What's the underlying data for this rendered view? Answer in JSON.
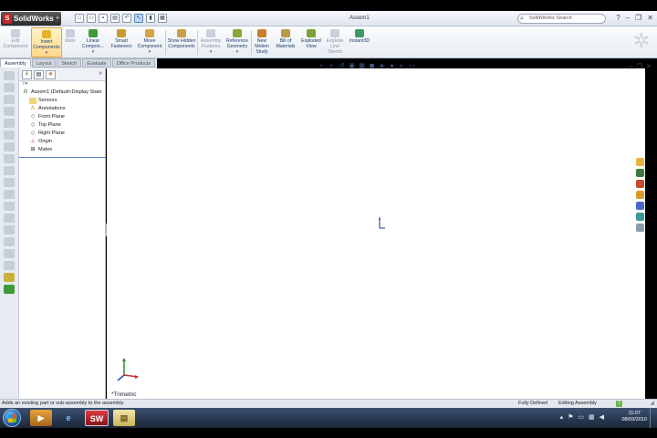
{
  "app": {
    "logo_text": "SolidWorks",
    "window_title": "Assem1",
    "search_placeholder": "SolidWorks Search"
  },
  "commands": [
    {
      "id": "edit-component",
      "label": "Edit Component",
      "enabled": false
    },
    {
      "id": "insert-components",
      "label": "Insert Components",
      "enabled": true,
      "active": true
    },
    {
      "id": "mate",
      "label": "Mate",
      "enabled": false
    },
    {
      "id": "linear-component-pattern",
      "label": "Linear Compon...",
      "enabled": true
    },
    {
      "id": "smart-fasteners",
      "label": "Smart Fasteners",
      "enabled": true
    },
    {
      "id": "move-component",
      "label": "Move Component",
      "enabled": true
    },
    {
      "id": "show-hidden-components",
      "label": "Show Hidden Components",
      "enabled": true
    },
    {
      "id": "assembly-features",
      "label": "Assembly Features",
      "enabled": false
    },
    {
      "id": "reference-geometry",
      "label": "Reference Geometry",
      "enabled": true
    },
    {
      "id": "new-motion-study",
      "label": "New Motion Study",
      "enabled": true
    },
    {
      "id": "bill-of-materials",
      "label": "Bill of Materials",
      "enabled": true
    },
    {
      "id": "exploded-view",
      "label": "Exploded View",
      "enabled": true
    },
    {
      "id": "explode-line-sketch",
      "label": "Explode Line Sketch",
      "enabled": false
    },
    {
      "id": "instant3d",
      "label": "Instant3D",
      "enabled": true
    }
  ],
  "tabs": [
    {
      "label": "Assembly",
      "active": true
    },
    {
      "label": "Layout",
      "active": false
    },
    {
      "label": "Sketch",
      "active": false
    },
    {
      "label": "Evaluate",
      "active": false
    },
    {
      "label": "Office Products",
      "active": false
    }
  ],
  "tree": {
    "root": "Assem1  (Default<Display State",
    "items": [
      "Sensors",
      "Annotations",
      "Front Plane",
      "Top Plane",
      "Right Plane",
      "Origin",
      "Mates"
    ]
  },
  "viewport": {
    "view_name": "*Trimetric"
  },
  "status": {
    "message": "Adds an existing part or sub-assembly to the assembly.",
    "state": "Fully Defined",
    "mode": "Editing Assembly"
  },
  "taskbar": {
    "time": "11:07",
    "date": "08/03/2010"
  },
  "colors": {
    "accent": "#1c3b6e",
    "active_highlight": "#ffd98a",
    "tree_line": "#5a7ec2"
  }
}
